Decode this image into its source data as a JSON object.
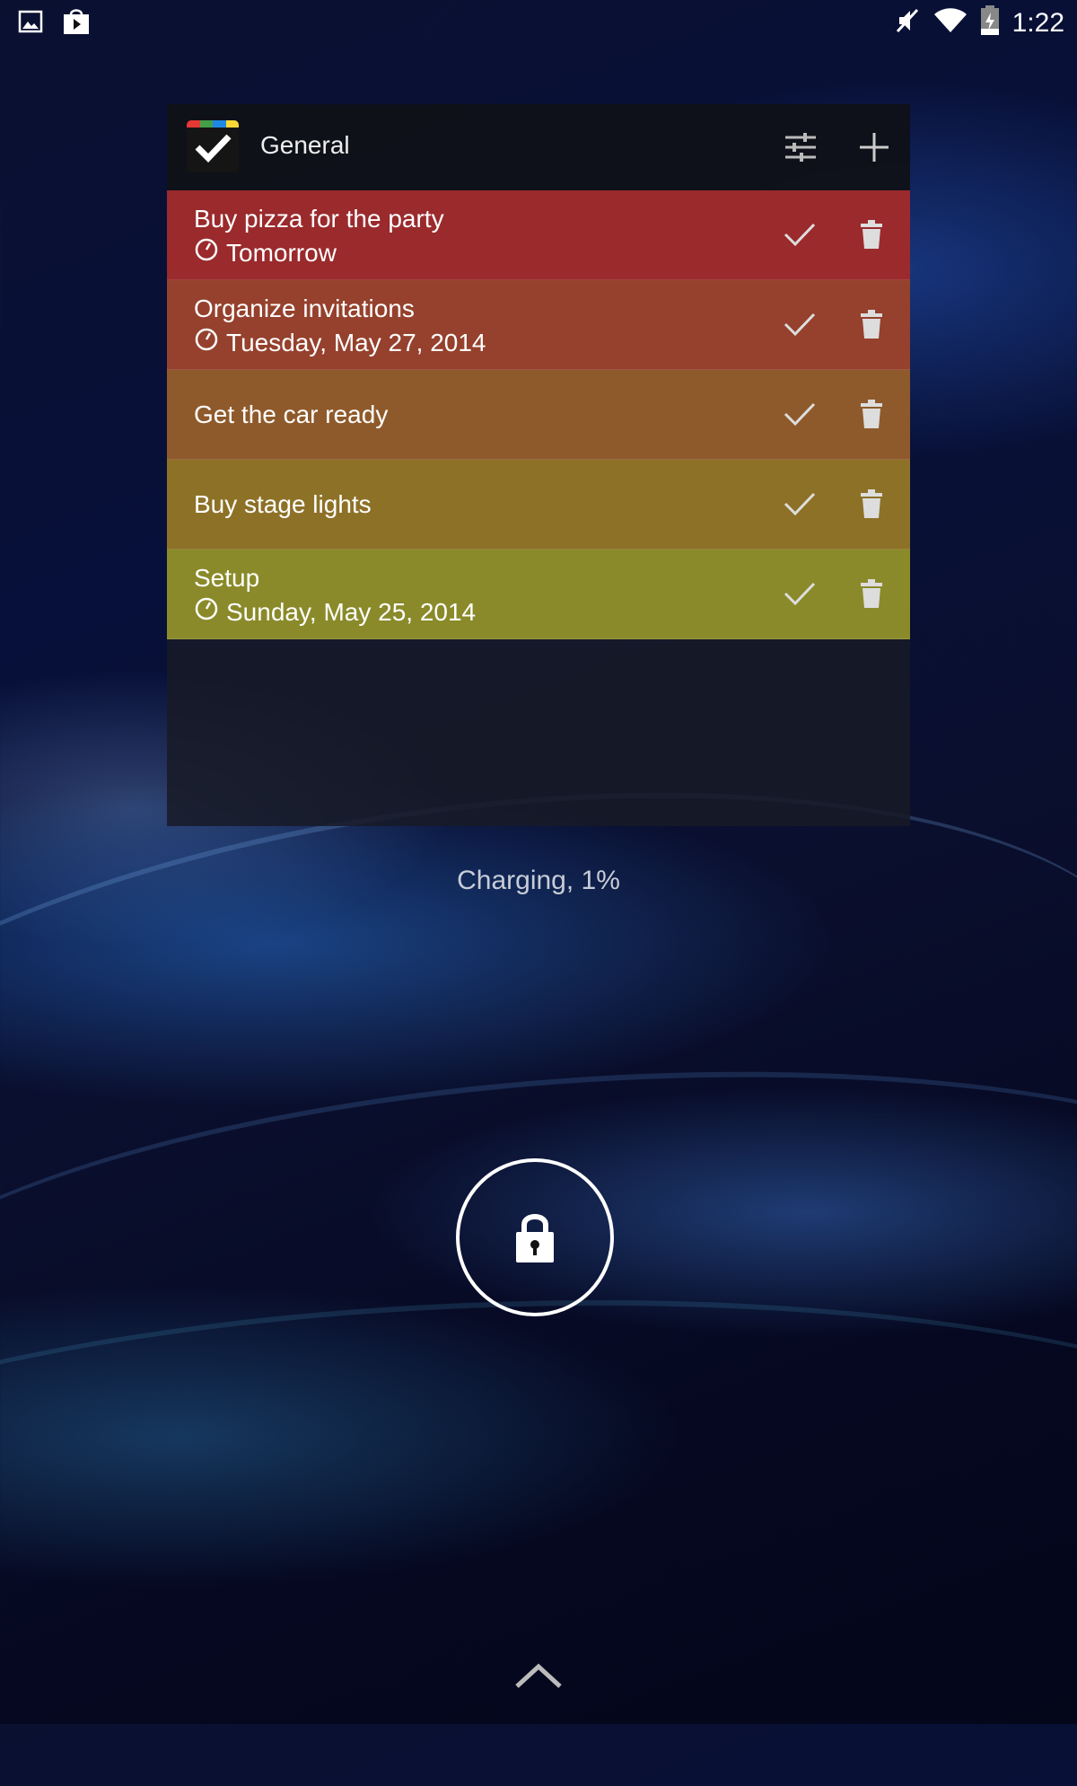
{
  "status_bar": {
    "time": "1:22",
    "left_icons": [
      "image-icon",
      "play-store-icon"
    ],
    "right_icons": [
      "mute-icon",
      "wifi-icon",
      "battery-charging-icon"
    ]
  },
  "widget": {
    "title": "General",
    "header_buttons": [
      "settings-sliders-icon",
      "add-icon"
    ],
    "tasks": [
      {
        "name": "Buy pizza for the party",
        "due": "Tomorrow",
        "color": "#9a2a2c"
      },
      {
        "name": "Organize invitations",
        "due": "Tuesday, May 27, 2014",
        "color": "#95412d"
      },
      {
        "name": "Get the car ready",
        "due": "",
        "color": "#8f5a2b"
      },
      {
        "name": "Buy stage lights",
        "due": "",
        "color": "#8d7127"
      },
      {
        "name": "Setup",
        "due": "Sunday, May 25, 2014",
        "color": "#8a8a2a"
      }
    ]
  },
  "lockscreen": {
    "charging_status": "Charging, 1%",
    "lock_icon": "lock-icon",
    "unlock_hint_icon": "chevron-up-icon"
  }
}
